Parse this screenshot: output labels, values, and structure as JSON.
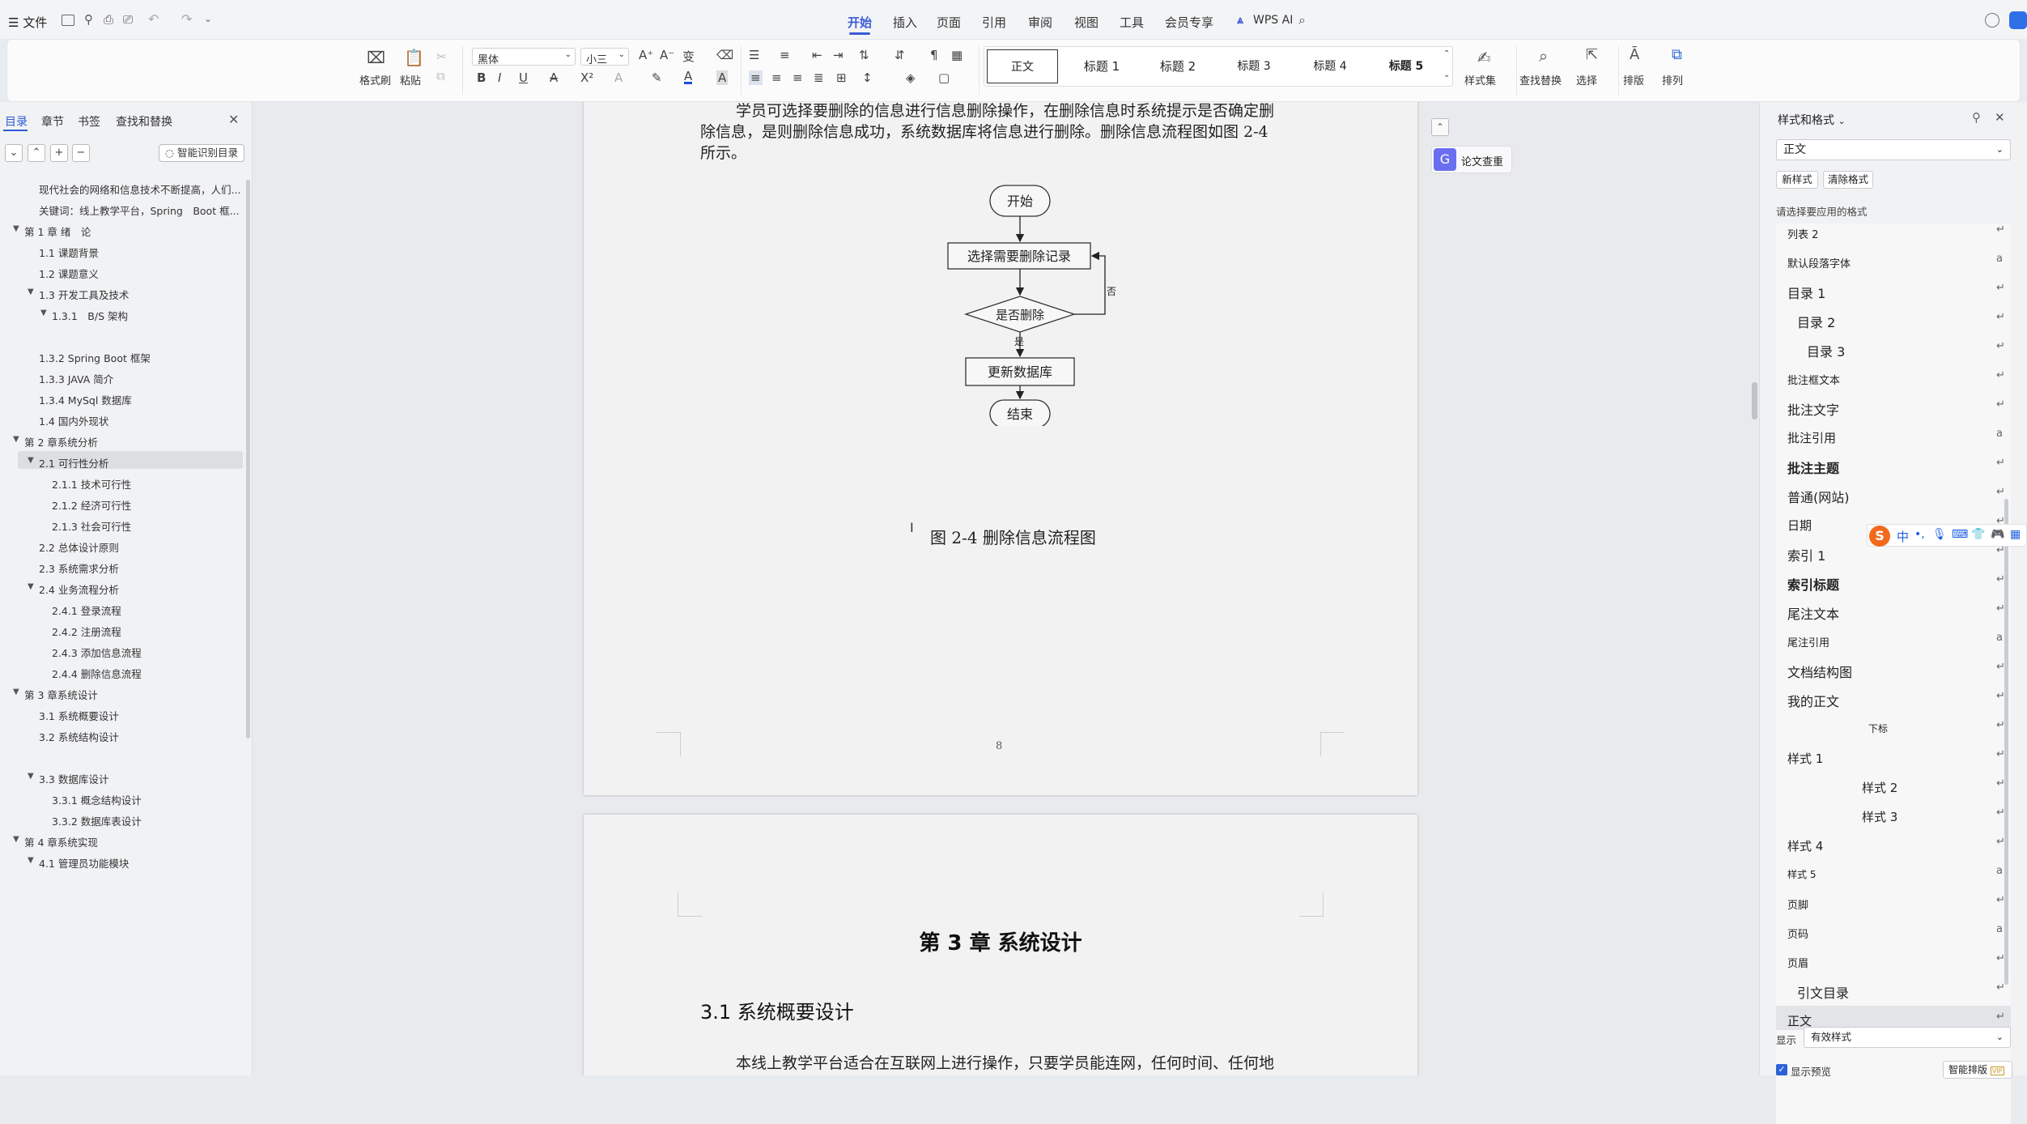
{
  "menubar": {
    "file": "文件",
    "tabs": [
      "开始",
      "插入",
      "页面",
      "引用",
      "审阅",
      "视图",
      "工具",
      "会员专享"
    ],
    "wps_ai": "WPS AI"
  },
  "ribbon": {
    "format_painter": "格式刷",
    "paste": "粘贴",
    "font_name": "黑体",
    "font_size": "小三",
    "styles": [
      "正文",
      "标题 1",
      "标题 2",
      "标题 3",
      "标题 4",
      "标题 5"
    ],
    "style_set": "样式集",
    "find_replace": "查找替换",
    "select": "选择",
    "layout": "排版",
    "arrange": "排列"
  },
  "left_pane": {
    "tabs": [
      "目录",
      "章节",
      "书签",
      "查找和替换"
    ],
    "smart_toc": "智能识别目录",
    "toc": [
      {
        "text": "现代社会的网络和信息技术不断提高，人们...",
        "level": 2,
        "caret": ""
      },
      {
        "text": "关键词：线上教学平台，Spring　Boot 框...",
        "level": 2,
        "caret": ""
      },
      {
        "text": "第 1 章  绪　论",
        "level": 1,
        "caret": "▼"
      },
      {
        "text": "1.1 课题背景",
        "level": 2,
        "caret": ""
      },
      {
        "text": "1.2  课题意义",
        "level": 2,
        "caret": ""
      },
      {
        "text": "1.3  开发工具及技术",
        "level": 2,
        "caret": "▼"
      },
      {
        "text": "1.3.1　B/S 架构",
        "level": 3,
        "caret": "▼"
      },
      {
        "text": "",
        "level": 3,
        "caret": ""
      },
      {
        "text": "1.3.2 Spring Boot 框架",
        "level": 2,
        "caret": ""
      },
      {
        "text": "1.3.3 JAVA 简介",
        "level": 2,
        "caret": ""
      },
      {
        "text": "1.3.4 MySql 数据库",
        "level": 2,
        "caret": ""
      },
      {
        "text": "1.4  国内外现状",
        "level": 2,
        "caret": ""
      },
      {
        "text": "第 2 章系统分析",
        "level": 1,
        "caret": "▼"
      },
      {
        "text": "2.1  可行性分析",
        "level": 2,
        "caret": "▼",
        "selected": true
      },
      {
        "text": "2.1.1 技术可行性",
        "level": 3,
        "caret": ""
      },
      {
        "text": "2.1.2 经济可行性",
        "level": 3,
        "caret": ""
      },
      {
        "text": "2.1.3 社会可行性",
        "level": 3,
        "caret": ""
      },
      {
        "text": "2.2 总体设计原则",
        "level": 2,
        "caret": ""
      },
      {
        "text": "2.3  系统需求分析",
        "level": 2,
        "caret": ""
      },
      {
        "text": "2.4  业务流程分析",
        "level": 2,
        "caret": "▼"
      },
      {
        "text": "2.4.1 登录流程",
        "level": 3,
        "caret": ""
      },
      {
        "text": "2.4.2 注册流程",
        "level": 3,
        "caret": ""
      },
      {
        "text": "2.4.3 添加信息流程",
        "level": 3,
        "caret": ""
      },
      {
        "text": "2.4.4 删除信息流程",
        "level": 3,
        "caret": ""
      },
      {
        "text": "第 3 章系统设计",
        "level": 1,
        "caret": "▼"
      },
      {
        "text": "3.1  系统概要设计",
        "level": 2,
        "caret": ""
      },
      {
        "text": "3.2 系统结构设计",
        "level": 2,
        "caret": ""
      },
      {
        "text": "",
        "level": 2,
        "caret": ""
      },
      {
        "text": "3.3  数据库设计",
        "level": 2,
        "caret": "▼"
      },
      {
        "text": "3.3.1 概念结构设计",
        "level": 3,
        "caret": ""
      },
      {
        "text": "3.3.2 数据库表设计",
        "level": 3,
        "caret": ""
      },
      {
        "text": "第 4 章系统实现",
        "level": 1,
        "caret": "▼"
      },
      {
        "text": "4.1 管理员功能模块",
        "level": 2,
        "caret": "▼"
      }
    ]
  },
  "document": {
    "para_lines": [
      "学员可选择要删除的信息进行信息删除操作，在删除信息时系统提示是否确定删",
      "除信息，是则删除信息成功，系统数据库将信息进行删除。删除信息流程图如图 2-4",
      "所示。"
    ],
    "flow": {
      "start": "开始",
      "select": "选择需要删除记录",
      "decision": "是否删除",
      "no": "否",
      "yes": "是",
      "update": "更新数据库",
      "end": "结束"
    },
    "figure_caption": "图 2-4 删除信息流程图",
    "page_number": "8",
    "chapter_title": "第 3 章  系统设计",
    "section_title": "3.1  系统概要设计",
    "body_line": "本线上教学平台适合在互联网上进行操作，只要学员能连网，任何时间、任何地"
  },
  "float_tools": {
    "paper_check": "论文查重"
  },
  "right_pane": {
    "title": "样式和格式",
    "current_style": "正文",
    "new_style": "新样式",
    "clear_format": "清除格式",
    "hint": "请选择要应用的格式",
    "styles": [
      {
        "name": "列表 2",
        "mark": "↵",
        "indent": 0,
        "size": 13,
        "bold": false
      },
      {
        "name": "默认段落字体",
        "mark": "a",
        "indent": 0,
        "size": 13,
        "bold": false
      },
      {
        "name": "目录 1",
        "mark": "↵",
        "indent": 0,
        "size": 16,
        "bold": false
      },
      {
        "name": "目录 2",
        "mark": "↵",
        "indent": 12,
        "size": 16,
        "bold": false
      },
      {
        "name": "目录 3",
        "mark": "↵",
        "indent": 24,
        "size": 16,
        "bold": false
      },
      {
        "name": "批注框文本",
        "mark": "↵",
        "indent": 0,
        "size": 13,
        "bold": false
      },
      {
        "name": "批注文字",
        "mark": "↵",
        "indent": 0,
        "size": 16,
        "bold": false
      },
      {
        "name": "批注引用",
        "mark": "a",
        "indent": 0,
        "size": 15,
        "bold": false
      },
      {
        "name": "批注主题",
        "mark": "↵",
        "indent": 0,
        "size": 16,
        "bold": true
      },
      {
        "name": "普通(网站)",
        "mark": "↵",
        "indent": 0,
        "size": 16,
        "bold": false
      },
      {
        "name": "日期",
        "mark": "↵",
        "indent": 0,
        "size": 15,
        "bold": false
      },
      {
        "name": "索引 1",
        "mark": "↵",
        "indent": 0,
        "size": 16,
        "bold": false
      },
      {
        "name": "索引标题",
        "mark": "↵",
        "indent": 0,
        "size": 16,
        "bold": true
      },
      {
        "name": "尾注文本",
        "mark": "↵",
        "indent": 0,
        "size": 16,
        "bold": false
      },
      {
        "name": "尾注引用",
        "mark": "a",
        "indent": 0,
        "size": 13,
        "bold": false
      },
      {
        "name": "文档结构图",
        "mark": "↵",
        "indent": 0,
        "size": 16,
        "bold": false
      },
      {
        "name": "我的正文",
        "mark": "↵",
        "indent": 0,
        "size": 16,
        "bold": false
      },
      {
        "name": "下标",
        "mark": "↵",
        "indent": 100,
        "size": 12,
        "bold": false
      },
      {
        "name": "样式 1",
        "mark": "↵",
        "indent": 0,
        "size": 15,
        "bold": false
      },
      {
        "name": "样式 2",
        "mark": "↵",
        "indent": 92,
        "size": 15,
        "bold": false
      },
      {
        "name": "样式 3",
        "mark": "↵",
        "indent": 92,
        "size": 15,
        "bold": false
      },
      {
        "name": "样式 4",
        "mark": "↵",
        "indent": 0,
        "size": 15,
        "bold": false
      },
      {
        "name": "样式 5",
        "mark": "a",
        "indent": 0,
        "size": 12,
        "bold": false
      },
      {
        "name": "页脚",
        "mark": "↵",
        "indent": 0,
        "size": 13,
        "bold": false
      },
      {
        "name": "页码",
        "mark": "a",
        "indent": 0,
        "size": 13,
        "bold": false
      },
      {
        "name": "页眉",
        "mark": "↵",
        "indent": 0,
        "size": 13,
        "bold": false
      },
      {
        "name": "引文目录",
        "mark": "↵",
        "indent": 12,
        "size": 16,
        "bold": false
      },
      {
        "name": "正文",
        "mark": "↵",
        "indent": 0,
        "size": 15,
        "bold": false
      }
    ],
    "show_label": "显示",
    "show_value": "有效样式",
    "show_preview": "显示预览",
    "smart_layout": "智能排版"
  },
  "ime": {
    "mode": "中"
  }
}
